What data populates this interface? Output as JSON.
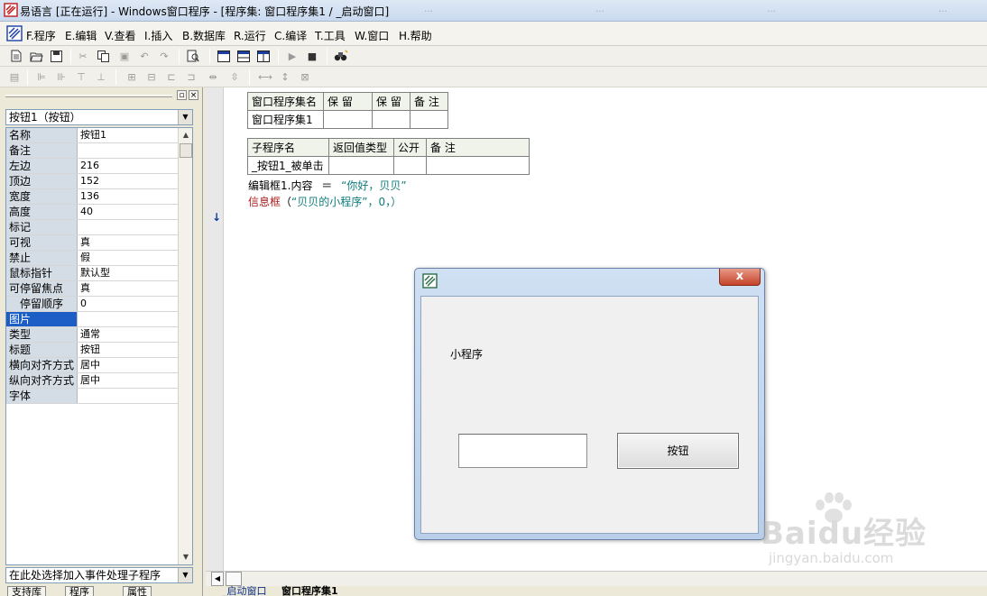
{
  "window": {
    "title": "易语言 [正在运行] - Windows窗口程序 - [程序集: 窗口程序集1 / _启动窗口]",
    "bg_tasks": [
      "…",
      "…",
      "…",
      "…"
    ]
  },
  "menu": [
    "F.程序",
    "E.编辑",
    "V.查看",
    "I.插入",
    "B.数据库",
    "R.运行",
    "C.编译",
    "T.工具",
    "W.窗口",
    "H.帮助"
  ],
  "left_panel": {
    "component_combo": "按钮1（按钮）",
    "event_combo": "在此处选择加入事件处理子程序",
    "properties": [
      {
        "name": "名称",
        "value": "按钮1"
      },
      {
        "name": "备注",
        "value": ""
      },
      {
        "name": "左边",
        "value": "216"
      },
      {
        "name": "顶边",
        "value": "152"
      },
      {
        "name": "宽度",
        "value": "136"
      },
      {
        "name": "高度",
        "value": "40"
      },
      {
        "name": "标记",
        "value": ""
      },
      {
        "name": "可视",
        "value": "真"
      },
      {
        "name": "禁止",
        "value": "假"
      },
      {
        "name": "鼠标指针",
        "value": "默认型"
      },
      {
        "name": "可停留焦点",
        "value": "真"
      },
      {
        "name": "停留顺序",
        "value": "0"
      },
      {
        "name": "图片",
        "value": ""
      },
      {
        "name": "类型",
        "value": "通常"
      },
      {
        "name": "标题",
        "value": "按钮"
      },
      {
        "name": "横向对齐方式",
        "value": "居中"
      },
      {
        "name": "纵向对齐方式",
        "value": "居中"
      },
      {
        "name": "字体",
        "value": ""
      }
    ],
    "selected_property": "图片",
    "bottom_tabs": [
      "支持库",
      "程序",
      "属性"
    ]
  },
  "code": {
    "assembly_table": {
      "headers": [
        "窗口程序集名",
        "保 留",
        "保 留",
        "备 注"
      ],
      "row": [
        "窗口程序集1",
        "",
        "",
        ""
      ]
    },
    "sub_table": {
      "headers": [
        "子程序名",
        "返回值类型",
        "公开",
        "备 注"
      ],
      "row": [
        "_按钮1_被单击",
        "",
        "",
        ""
      ]
    },
    "line1": {
      "obj": "编辑框1.内容",
      "op": "＝",
      "str": "“你好，贝贝”"
    },
    "line2": {
      "func": "信息框",
      "open": "（",
      "str": "“贝贝的小程序”",
      "rest": "，0，）"
    },
    "tabs": [
      "_启动窗口",
      "窗口程序集1"
    ]
  },
  "run_window": {
    "close_glyph": "x",
    "label": "小程序",
    "button": "按钮"
  },
  "watermark": {
    "text": "Baidu经验",
    "sub": "jingyan.baidu.com"
  }
}
